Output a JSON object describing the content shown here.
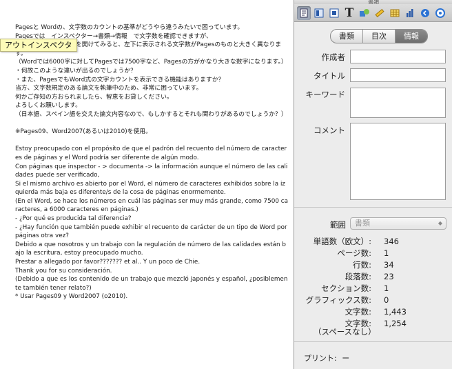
{
  "document": {
    "body": "Pagesと Wordの、文字数のカウントの基準がどうやら違うみたいで困っています。\nPagesでは　インスペクター→書類→情報　で文字数を確認できますが、\n　　　　　　　　　　を開けてみると、左下に表示される文字数がPagesのものと大きく異なります。\n（Wordでは6000字に対してPagesでは7500字など、Pagesの方がかなり大きな数字になります。）\n・何故このような違いが出るのでしょうか？\n・また、PagesでもWord式の文字カウントを表示できる機能はありますか？\n当方、文字数規定のある論文を執筆中のため、非常に困っています。\n何かご存知の方おられましたら、智恵をお貸しください。\nよろしくお願いします。\n（日本語、スペイン語を交えた論文内容なので、もしかするとそれも関わりがあるのでしょうか？）\n\n※Pages09、Word2007(あるいは2010)を使用。\n\nEstoy preocupado con el propósito de que el padrón del recuento del número de caracteres de páginas y el Word podría ser diferente de algún modo.\nCon páginas que inspector - > documenta -> la información aunque el número de las calidades puede ser verificado,\nSi el mismo archivo es abierto por el Word, el número de caracteres exhibidos sobre la izquierda más baja es diferente/s de la cosa de páginas enormemente.\n(En el Word, se hace los números en cuál las páginas ser muy más grande, como 7500 caracteres, a 6000 caracteres en páginas.)\n- ¿Por qué es producida tal diferencia?\n- ¿Hay función que también puede exhibir el recuento de carácter de un tipo de Word por páginas otra vez?\nDebido a que nosotros y un trabajo con la regulación de número de las calidades están bajo la escritura, estoy preocupado mucho.\nPrestar a allegado por favor??????? et al.. Y un poco de Chie.\nThank you for su consideración.\n(Debido a que es los contenido de un trabajo que mezcló japonés y español, ¿posiblemente también tener relato?)\n* Usar Pages09 y Word2007 (o2010)."
  },
  "tooltip": "アウトインスペクタ",
  "inspector": {
    "window_title": "書類",
    "toolbar_icons": [
      "document-icon",
      "layout-icon",
      "wrap-icon",
      "text-icon",
      "graphic-icon",
      "metrics-icon",
      "table-icon",
      "chart-icon",
      "link-icon",
      "quicktime-icon"
    ],
    "tabs": [
      "書類",
      "目次",
      "情報"
    ],
    "active_tab": "情報",
    "fields": {
      "author_label": "作成者",
      "title_label": "タイトル",
      "keyword_label": "キーワード",
      "comment_label": "コメント"
    },
    "range": {
      "label": "範囲",
      "value": "書類"
    },
    "stats": [
      {
        "label": "単語数（欧文）:",
        "value": "346"
      },
      {
        "label": "ページ数:",
        "value": "1"
      },
      {
        "label": "行数:",
        "value": "34"
      },
      {
        "label": "段落数:",
        "value": "23"
      },
      {
        "label": "セクション数:",
        "value": "1"
      },
      {
        "label": "グラフィックス数:",
        "value": "0"
      },
      {
        "label": "文字数:",
        "value": "1,443"
      },
      {
        "label": "文字数:",
        "value": "1,254"
      }
    ],
    "stats_note": "（スペースなし）",
    "print_label": "プリント:",
    "print_value": "ー"
  },
  "colors": {
    "accent": "#2a5aa8",
    "tooltip_bg": "#fdfbb8",
    "panel_bg": "#ececec"
  }
}
